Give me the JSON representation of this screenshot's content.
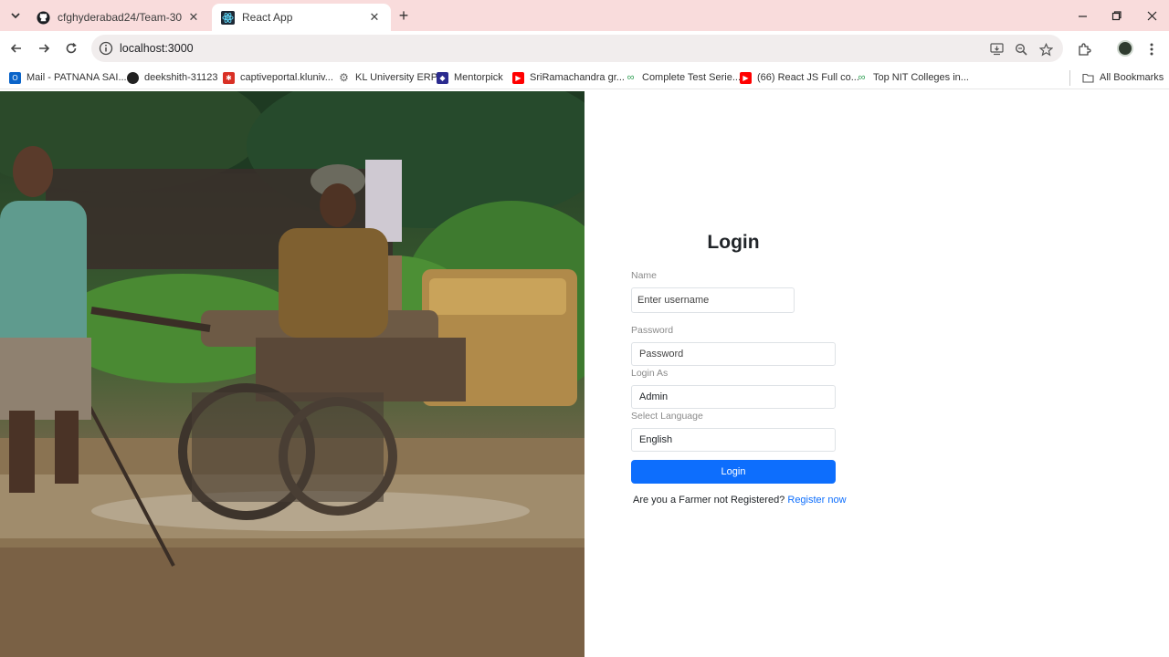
{
  "browser": {
    "tabs": [
      {
        "title": "cfghyderabad24/Team-30",
        "active": false,
        "icon": "github-icon"
      },
      {
        "title": "React App",
        "active": true,
        "icon": "react-icon"
      }
    ],
    "url": "localhost:3000",
    "bookmarks": [
      {
        "label": "Mail - PATNANA SAI...",
        "icon": "outlook-icon",
        "color": "#0a64c9"
      },
      {
        "label": "deekshith-31123",
        "icon": "github-icon",
        "color": "#222222"
      },
      {
        "label": "captiveportal.kluniv...",
        "icon": "portal-icon",
        "color": "#d93025"
      },
      {
        "label": "KL University ERP",
        "icon": "gear-icon",
        "color": "#666666"
      },
      {
        "label": "Mentorpick",
        "icon": "mentorpick-icon",
        "color": "#2b2b8f"
      },
      {
        "label": "SriRamachandra gr...",
        "icon": "youtube-icon",
        "color": "#ff0000"
      },
      {
        "label": "Complete Test Serie...",
        "icon": "link-icon",
        "color": "#2e9e52"
      },
      {
        "label": "(66) React JS Full co...",
        "icon": "youtube-icon",
        "color": "#ff0000"
      },
      {
        "label": "Top NIT Colleges in...",
        "icon": "link-icon",
        "color": "#2e9e52"
      }
    ],
    "all_bookmarks_label": "All Bookmarks"
  },
  "hero_image": {
    "alt": "Farmers ploughing a muddy rice paddy with a power tiller"
  },
  "login": {
    "title": "Login",
    "name_label": "Name",
    "name_placeholder": "Enter username",
    "password_label": "Password",
    "password_placeholder": "Password",
    "login_as_label": "Login As",
    "login_as_value": "Admin",
    "language_label": "Select Language",
    "language_value": "English",
    "button_label": "Login",
    "register_prompt": "Are you a Farmer not Registered?",
    "register_link": "Register now"
  },
  "colors": {
    "primary": "#0d6efd",
    "tabstrip": "#f9dcdc"
  }
}
